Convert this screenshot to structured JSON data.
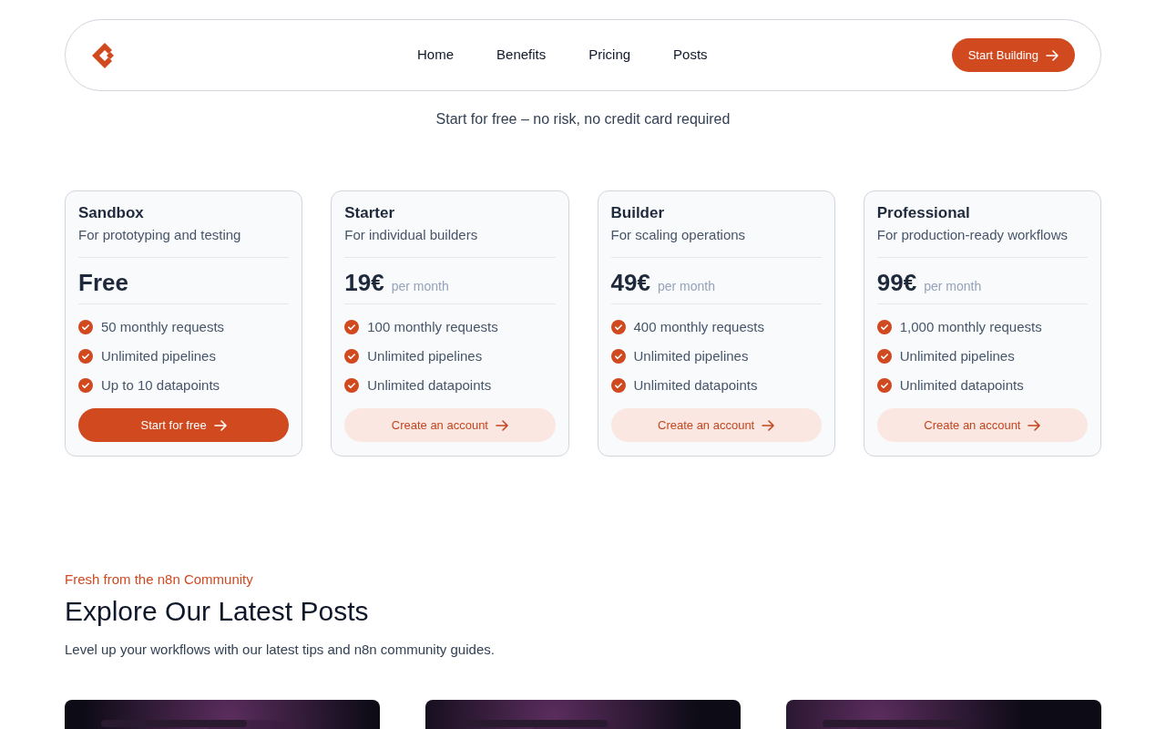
{
  "nav": {
    "links": [
      {
        "label": "Home"
      },
      {
        "label": "Benefits"
      },
      {
        "label": "Pricing"
      },
      {
        "label": "Posts"
      }
    ],
    "cta": "Start Building"
  },
  "pricing": {
    "subtitle": "Start for free – no risk, no credit card required",
    "plans": [
      {
        "name": "Sandbox",
        "tagline": "For prototyping and testing",
        "price": "Free",
        "features": [
          "50 monthly requests",
          "Unlimited pipelines",
          "Up to 10 datapoints"
        ],
        "button": "Start for free",
        "kind": "primary"
      },
      {
        "name": "Starter",
        "tagline": "For individual builders",
        "price": "19€",
        "period": "per month",
        "features": [
          "100 monthly requests",
          "Unlimited pipelines",
          "Unlimited datapoints"
        ],
        "button": "Create an account",
        "kind": "secondary"
      },
      {
        "name": "Builder",
        "tagline": "For scaling operations",
        "price": "49€",
        "period": "per month",
        "features": [
          "400 monthly requests",
          "Unlimited pipelines",
          "Unlimited datapoints"
        ],
        "button": "Create an account",
        "kind": "secondary"
      },
      {
        "name": "Professional",
        "tagline": "For production-ready workflows",
        "price": "99€",
        "period": "per month",
        "features": [
          "1,000 monthly requests",
          "Unlimited pipelines",
          "Unlimited datapoints"
        ],
        "button": "Create an account",
        "kind": "secondary"
      }
    ]
  },
  "posts": {
    "eyebrow": "Fresh from the n8n Community",
    "title": "Explore Our Latest Posts",
    "description": "Level up your workflows with our latest tips and n8n community guides."
  }
}
